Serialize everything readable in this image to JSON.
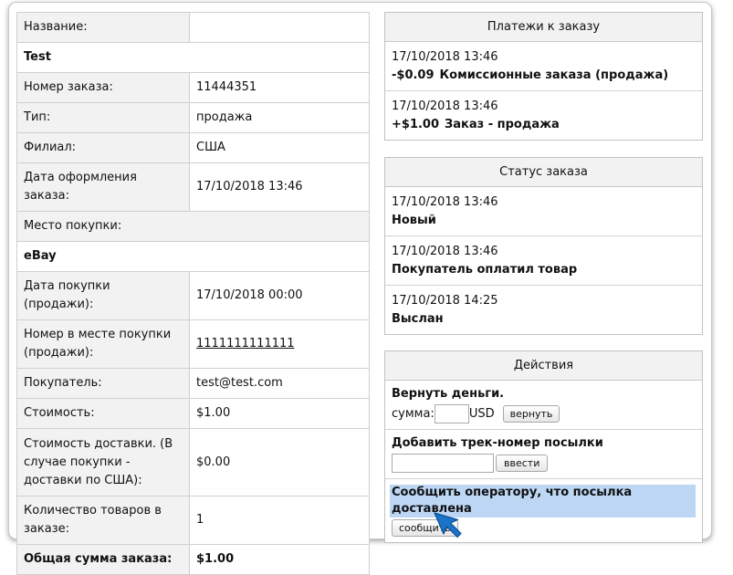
{
  "order_table": [
    {
      "label": "Название:",
      "value": "",
      "type": "kv"
    },
    {
      "label": "Test",
      "type": "full"
    },
    {
      "label": "Номер заказа:",
      "value": "11444351",
      "type": "kv"
    },
    {
      "label": "Тип:",
      "value": "продажа",
      "type": "kv"
    },
    {
      "label": "Филиал:",
      "value": "США",
      "type": "kv"
    },
    {
      "label": "Дата оформления заказа:",
      "value": "17/10/2018 13:46",
      "type": "kv"
    },
    {
      "label": "Место покупки:",
      "type": "plain"
    },
    {
      "label": "eBay",
      "type": "full"
    },
    {
      "label": "Дата покупки (продажи):",
      "value": "17/10/2018 00:00",
      "type": "kv"
    },
    {
      "label": "Номер в месте покупки (продажи):",
      "value": "1111111111111",
      "type": "kv",
      "link": true
    },
    {
      "label": "Покупатель:",
      "value": "test@test.com",
      "type": "kv"
    },
    {
      "label": "Стоимость:",
      "value": "$1.00",
      "type": "kv"
    },
    {
      "label": "Стоимость доставки. (В случае покупки - доставки по США):",
      "value": "$0.00",
      "type": "kv"
    },
    {
      "label": "Количество товаров в заказе:",
      "value": "1",
      "type": "kv"
    },
    {
      "label": "Общая сумма заказа:",
      "value": "$1.00",
      "type": "total"
    }
  ],
  "payments": {
    "title": "Платежи к заказу",
    "entries": [
      {
        "time": "17/10/2018 13:46",
        "amount": "-$0.09",
        "desc": "Комиссионные заказа (продажа)"
      },
      {
        "time": "17/10/2018 13:46",
        "amount": "+$1.00",
        "desc": "Заказ - продажа"
      }
    ]
  },
  "status": {
    "title": "Статус заказа",
    "entries": [
      {
        "time": "17/10/2018 13:46",
        "desc": "Новый"
      },
      {
        "time": "17/10/2018 13:46",
        "desc": "Покупатель оплатил товар"
      },
      {
        "time": "17/10/2018 14:25",
        "desc": "Выслан"
      }
    ]
  },
  "actions": {
    "title": "Действия",
    "refund": {
      "heading": "Вернуть деньги.",
      "amount_label": "сумма:",
      "currency": "USD",
      "amount_value": "",
      "button": "вернуть"
    },
    "tracking": {
      "heading": "Добавить трек-номер посылки",
      "value": "",
      "button": "ввести"
    },
    "notify": {
      "heading": "Сообщить оператору, что посылка доставлена",
      "button": "сообщить"
    }
  },
  "colors": {
    "header_bg": "#f2f2f2",
    "highlight": "#bcd6f4",
    "cursor": "#1a73c8"
  },
  "icons": {
    "cursor": "arrow-cursor-icon"
  }
}
